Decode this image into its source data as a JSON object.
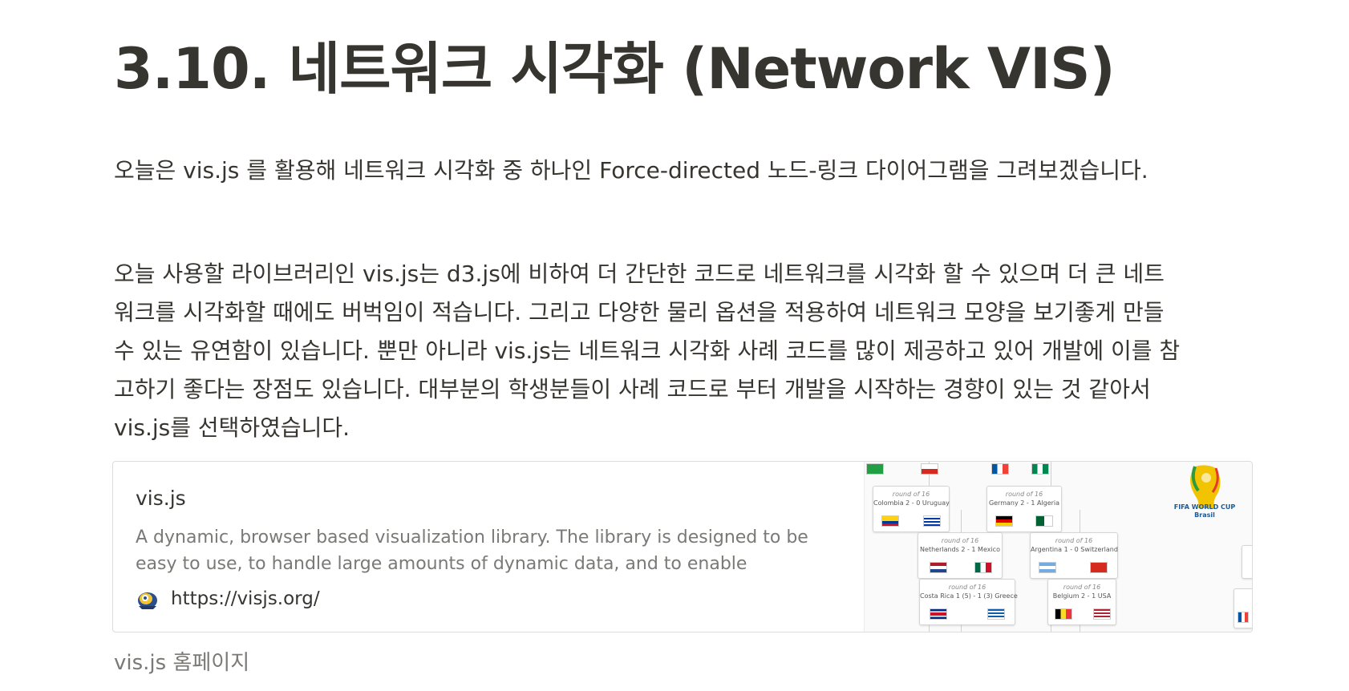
{
  "title": "3.10. 네트워크 시각화 (Network VIS)",
  "intro": "오늘은 vis.js 를 활용해 네트워크 시각화 중 하나인 Force-directed 노드-링크 다이어그램을 그려보겠습니다.",
  "body_lines": [
    "오늘 사용할 라이브러리인 vis.js는 d3.js에 비하여 더 간단한 코드로 네트워크를 시각화 할 수 있으며 더 큰 네트",
    "워크를 시각화할 때에도 버벅임이 적습니다. 그리고 다양한 물리 옵션을 적용하여 네트워크 모양을 보기좋게 만들",
    "수 있는 유연함이 있습니다. 뿐만 아니라 vis.js는 네트워크 시각화 사례 코드를 많이 제공하고 있어 개발에 이를 참",
    "고하기 좋다는 장점도 있습니다. 대부분의 학생분들이 사례 코드로 부터 개발을 시작하는 경향이 있는 것 같아서",
    "vis.js를 선택하였습니다."
  ],
  "bookmark": {
    "title": "vis.js",
    "description": "A dynamic, browser based visualization library. The library is designed to be easy to use, to handle large amounts of dynamic data, and to enable",
    "url": "https://visjs.org/",
    "favicon_icon": "visjs-helmet-icon",
    "thumbnail": {
      "round_label": "round of 16",
      "matches": [
        {
          "result": "Colombia 2 - 0 Uruguay"
        },
        {
          "result": "Germany 2 - 1 Algeria"
        },
        {
          "result": "Netherlands 2 - 1 Mexico"
        },
        {
          "result": "Argentina 1 - 0 Switzerland"
        },
        {
          "result": "Costa Rica 1 (5) - 1 (3) Greece"
        },
        {
          "result": "Belgium 2 - 1 USA"
        }
      ],
      "logo_text": "FIFA WORLD CUP Brasil"
    }
  },
  "caption": "vis.js 홈페이지"
}
